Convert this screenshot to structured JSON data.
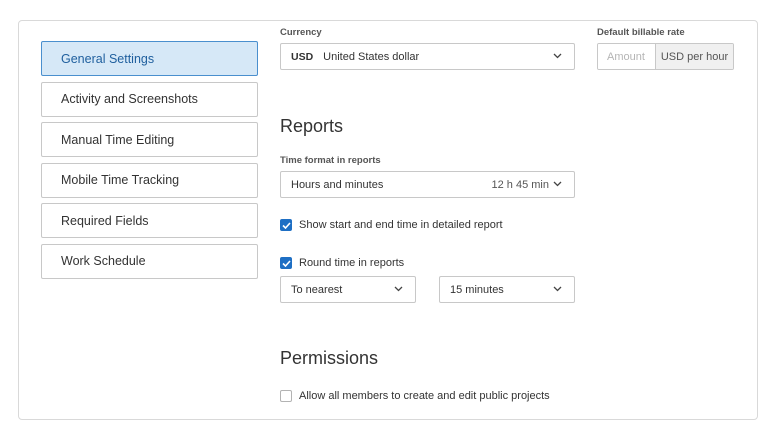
{
  "sidebar": {
    "items": [
      {
        "label": "General Settings",
        "active": true
      },
      {
        "label": "Activity and Screenshots",
        "active": false
      },
      {
        "label": "Manual Time Editing",
        "active": false
      },
      {
        "label": "Mobile Time Tracking",
        "active": false
      },
      {
        "label": "Required Fields",
        "active": false
      },
      {
        "label": "Work Schedule",
        "active": false
      }
    ]
  },
  "currency": {
    "label": "Currency",
    "code": "USD",
    "name": "United States dollar"
  },
  "billable_rate": {
    "label": "Default billable rate",
    "placeholder": "Amount",
    "unit": "USD per hour"
  },
  "reports": {
    "heading": "Reports",
    "time_format_label": "Time format in reports",
    "time_format_value": "Hours and minutes",
    "time_format_example": "12 h 45 min",
    "show_start_end_label": "Show start and end time in detailed report",
    "show_start_end_checked": true,
    "round_time_label": "Round time in reports",
    "round_time_checked": true,
    "round_mode": "To nearest",
    "round_interval": "15 minutes"
  },
  "permissions": {
    "heading": "Permissions",
    "allow_public_projects_label": "Allow all members to create and edit public projects",
    "allow_public_projects_checked": false
  },
  "colors": {
    "accent": "#1e6fc4",
    "active_nav_bg": "#d6e8f7",
    "border": "#c8c8c8"
  },
  "icons": {
    "dropdown": "chevron-down-icon",
    "checked": "checkmark-icon"
  }
}
